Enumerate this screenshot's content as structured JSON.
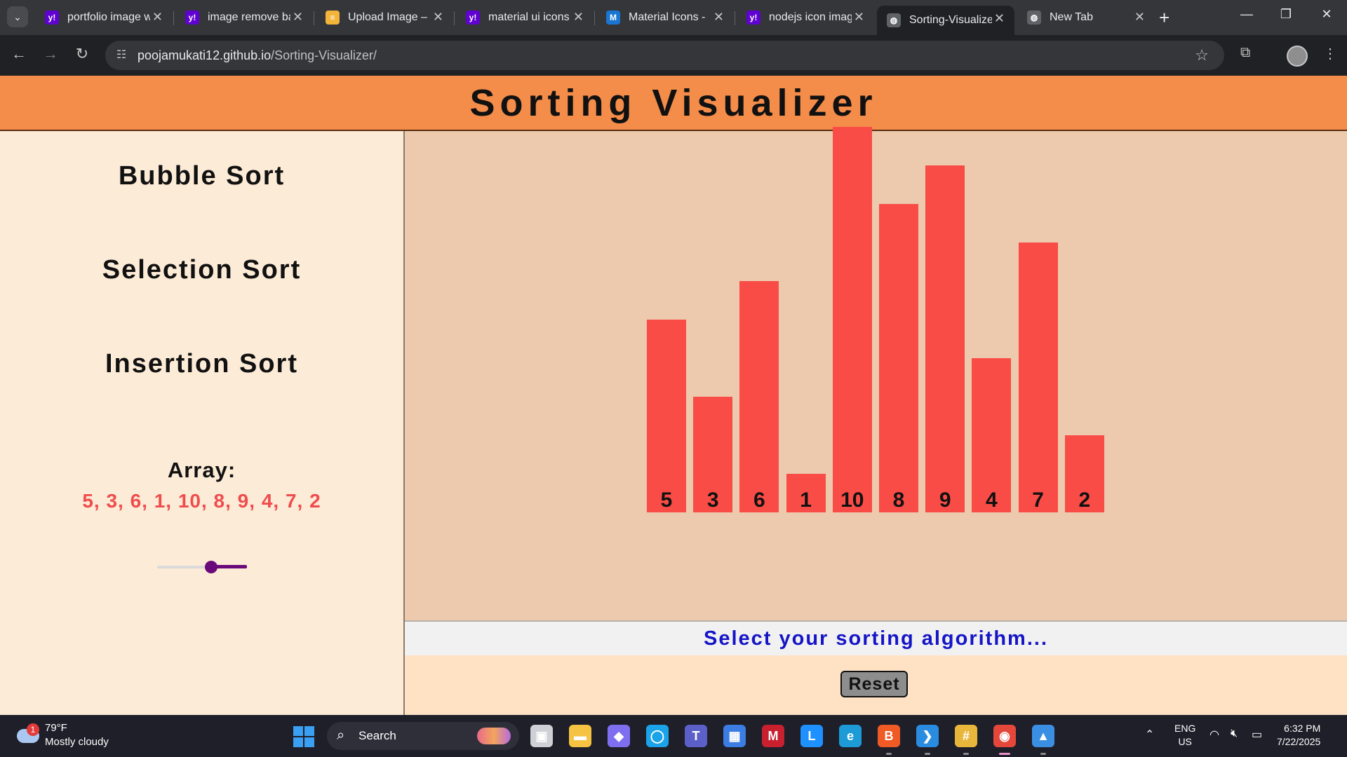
{
  "browser": {
    "tabs": [
      {
        "title": "portfolio image w",
        "favicon": "yahoo-icon",
        "color": "#5f01d1",
        "glyph": "y!"
      },
      {
        "title": "image remove ba",
        "favicon": "yahoo-icon",
        "color": "#5f01d1",
        "glyph": "y!"
      },
      {
        "title": "Upload Image – ",
        "favicon": "upload-icon",
        "color": "#f2b53a",
        "glyph": "≡"
      },
      {
        "title": "material ui icons",
        "favicon": "yahoo-icon",
        "color": "#5f01d1",
        "glyph": "y!"
      },
      {
        "title": "Material Icons - ",
        "favicon": "mui-icon",
        "color": "#1976d2",
        "glyph": "M"
      },
      {
        "title": "nodejs icon imag",
        "favicon": "yahoo-icon",
        "color": "#5f01d1",
        "glyph": "y!"
      },
      {
        "title": "Sorting-Visualize",
        "favicon": "globe-icon",
        "color": "#5f6368",
        "glyph": "◍"
      },
      {
        "title": "New Tab",
        "favicon": "globe-icon",
        "color": "#5f6368",
        "glyph": "◍"
      }
    ],
    "active_tab_index": 6,
    "url_host": "poojamukati12.github.io",
    "url_path": "/Sorting-Visualizer/"
  },
  "page": {
    "title": "Sorting Visualizer",
    "algorithms": [
      "Bubble Sort",
      "Selection Sort",
      "Insertion Sort"
    ],
    "array_label": "Array:",
    "array_values_text": "5, 3, 6, 1, 10, 8, 9, 4, 7, 2",
    "array": [
      5,
      3,
      6,
      1,
      10,
      8,
      9,
      4,
      7,
      2
    ],
    "speed_slider_fraction": 0.62,
    "status": "Select your sorting algorithm...",
    "reset_label": "Reset",
    "colors": {
      "header": "#f48c4a",
      "bar": "#f94c46",
      "array_text": "#ef4d4d",
      "status_text": "#1515c8",
      "slider": "#6a0a7a"
    }
  },
  "taskbar": {
    "weather_temp": "79°F",
    "weather_condition": "Mostly cloudy",
    "weather_badge": "1",
    "search_label": "Search",
    "apps": [
      "task-view-icon",
      "file-explorer-icon",
      "copilot-icon",
      "cortana-icon",
      "teams-icon",
      "store-icon",
      "mcafee-icon",
      "l-app-icon",
      "edge-icon",
      "brave-icon",
      "vscode-icon",
      "slack-icon",
      "chrome-icon",
      "photos-icon"
    ],
    "lang_line1": "ENG",
    "lang_line2": "US",
    "time": "6:32 PM",
    "date": "7/22/2025"
  }
}
